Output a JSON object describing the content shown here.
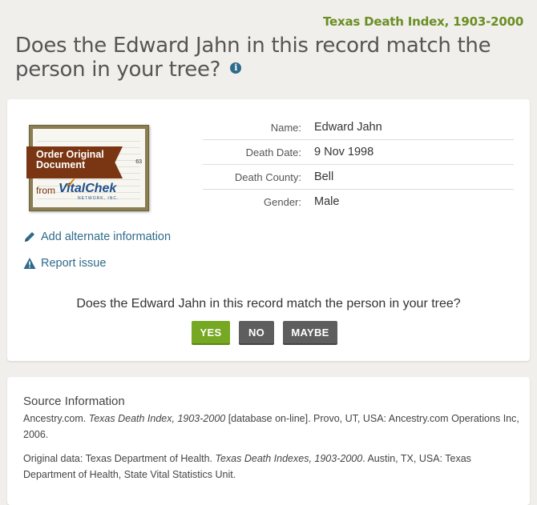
{
  "collection": {
    "title": "Texas Death Index, 1903-2000"
  },
  "page": {
    "title": "Does the Edward Jahn in this record match the person in your tree?"
  },
  "order": {
    "banner_line1": "Order Original",
    "banner_line2": "Document",
    "from": "from",
    "brand": "VitalChek",
    "brand_sub": "NETWORK, INC."
  },
  "record": {
    "fields": [
      {
        "label": "Name:",
        "value": "Edward Jahn"
      },
      {
        "label": "Death Date:",
        "value": "9 Nov 1998"
      },
      {
        "label": "Death County:",
        "value": "Bell"
      },
      {
        "label": "Gender:",
        "value": "Male"
      }
    ]
  },
  "actions": {
    "add_alternate": "Add alternate information",
    "report_issue": "Report issue"
  },
  "match": {
    "question": "Does the Edward Jahn in this record match the person in your tree?",
    "yes": "YES",
    "no": "NO",
    "maybe": "MAYBE"
  },
  "source": {
    "title": "Source Information",
    "p1_prefix": "Ancestry.com. ",
    "p1_italic": "Texas Death Index, 1903-2000",
    "p1_suffix": " [database on-line]. Provo, UT, USA: Ancestry.com Operations Inc, 2006.",
    "p2_prefix": "Original data: Texas Department of Health. ",
    "p2_italic": "Texas Death Indexes, 1903-2000",
    "p2_suffix": ". Austin, TX, USA: Texas Department of Health, State Vital Statistics Unit."
  },
  "colors": {
    "accent_green": "#6b8e23",
    "link_blue": "#2f6b8a",
    "yes_green": "#76a823",
    "neutral_button": "#5e5e5e",
    "order_banner": "#7a3512"
  }
}
